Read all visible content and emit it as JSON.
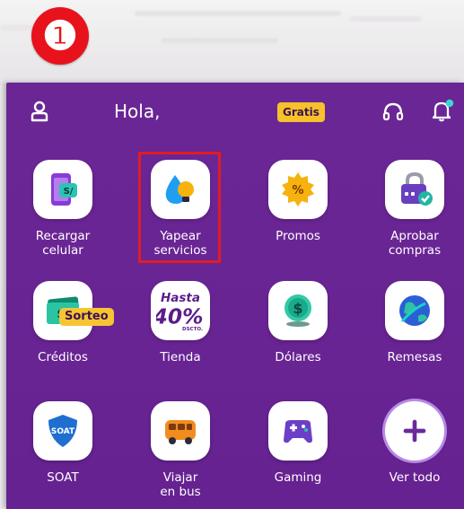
{
  "step": {
    "number": "❶",
    "color": "#e8121d"
  },
  "header": {
    "greeting": "Hola,",
    "gratis_badge": "Gratis",
    "icons": [
      "user-icon",
      "headset-icon",
      "bell-icon"
    ]
  },
  "grid": {
    "items": [
      {
        "label": "Recargar\ncelular",
        "icon": "phone-recharge-icon"
      },
      {
        "label": "Yapear\nservicios",
        "icon": "water-bulb-icon",
        "highlighted": true
      },
      {
        "label": "Promos",
        "icon": "promo-badge-icon"
      },
      {
        "label": "Aprobar\ncompras",
        "icon": "secure-card-icon"
      },
      {
        "label": "Créditos",
        "icon": "money-bill-icon"
      },
      {
        "label": "Tienda",
        "icon": "store-discount-icon",
        "badge_text": {
          "top": "Hasta",
          "main": "40%",
          "sub": "DSCTO."
        }
      },
      {
        "label": "Dólares",
        "icon": "dollar-coin-icon"
      },
      {
        "label": "Remesas",
        "icon": "globe-icon"
      },
      {
        "label": "SOAT",
        "icon": "soat-shield-icon",
        "badge": "Sorteo",
        "logo_text": "SOAT"
      },
      {
        "label": "Viajar\nen bus",
        "icon": "bus-icon"
      },
      {
        "label": "Gaming",
        "icon": "gamepad-icon"
      },
      {
        "label": "Ver todo",
        "icon": "plus-icon"
      }
    ],
    "recharge_text": "S/",
    "credit_text": "S/"
  },
  "colors": {
    "background": "#6a2694",
    "gratis": "#f6c12a",
    "highlight": "#e31b23",
    "accent_cyan": "#3ad6d0"
  }
}
